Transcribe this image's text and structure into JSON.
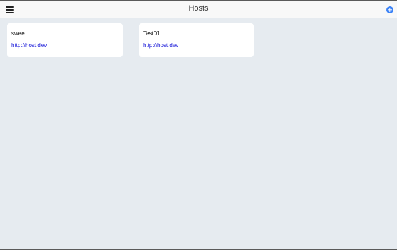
{
  "header": {
    "title": "Hosts",
    "menu_icon": "hamburger-menu-icon",
    "add_icon": "plus-circle-icon",
    "accent_color": "#3b82f6"
  },
  "hosts": [
    {
      "name": "sweet",
      "url": "http://host.dev"
    },
    {
      "name": "Test01",
      "url": "http://host.dev"
    }
  ]
}
